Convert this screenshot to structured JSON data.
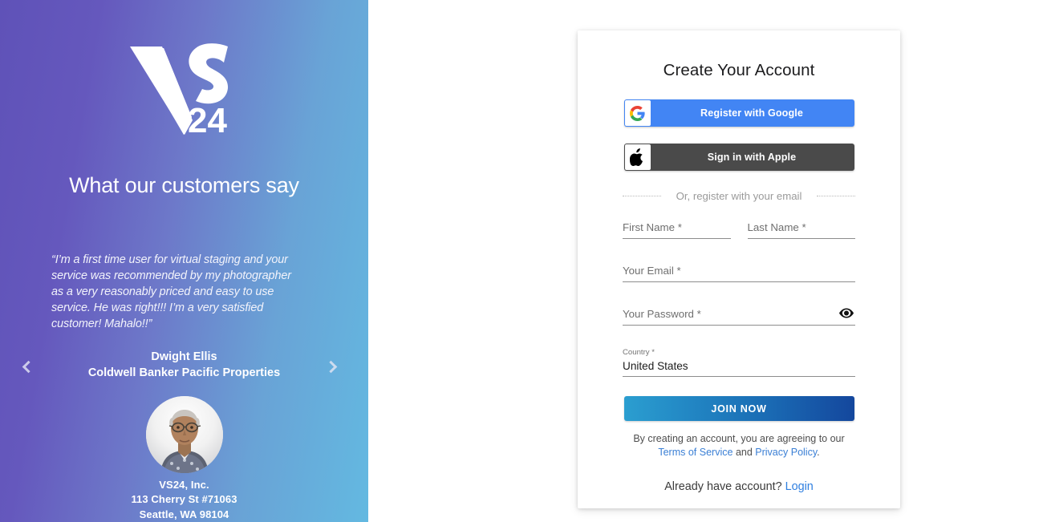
{
  "promo": {
    "logo_text": "VS24",
    "logo_letters": "VS",
    "logo_number": "24",
    "heading": "What our customers say",
    "testimonial": {
      "quote": "“I’m a first time user for virtual staging and your service was recommended by my photographer as a very reasonably priced and easy to use service. He was right!!! I’m a very satisfied customer! Mahalo!!”",
      "author": "Dwight Ellis",
      "company": "Coldwell Banker Pacific Properties"
    },
    "carousel": {
      "prev_label": "Previous testimonial",
      "next_label": "Next testimonial"
    },
    "company_info": {
      "name": "VS24, Inc.",
      "street": "113 Cherry St #71063",
      "city_state_zip": "Seattle, WA 98104"
    },
    "gradient_from": "#5f52b8",
    "gradient_to": "#63b9e1"
  },
  "signup": {
    "title": "Create Your Account",
    "google_button": {
      "label": "Register with Google",
      "icon": "google-g-icon",
      "color": "#4285f4"
    },
    "apple_button": {
      "label": "Sign in with Apple",
      "icon": "apple-logo-icon",
      "color": "#4a4a4a"
    },
    "divider_text": "Or, register with your email",
    "fields": {
      "first_name": {
        "placeholder": "First Name *",
        "value": ""
      },
      "last_name": {
        "placeholder": "Last Name *",
        "value": ""
      },
      "email": {
        "placeholder": "Your Email *",
        "value": ""
      },
      "password": {
        "placeholder": "Your Password *",
        "value": "",
        "toggle_icon": "eye-icon"
      },
      "country": {
        "label": "Country *",
        "value": "United States"
      }
    },
    "submit_label": "JOIN NOW",
    "terms": {
      "prefix": "By creating an account, you are agreeing to our",
      "terms_link": "Terms of Service",
      "conjunction": "and",
      "privacy_link": "Privacy Policy",
      "suffix": "."
    },
    "login_prompt": {
      "text": "Already have account?",
      "link": "Login"
    },
    "accent_color": "#2f7fe0",
    "submit_gradient_from": "#2b9ed0",
    "submit_gradient_to": "#14479d"
  }
}
